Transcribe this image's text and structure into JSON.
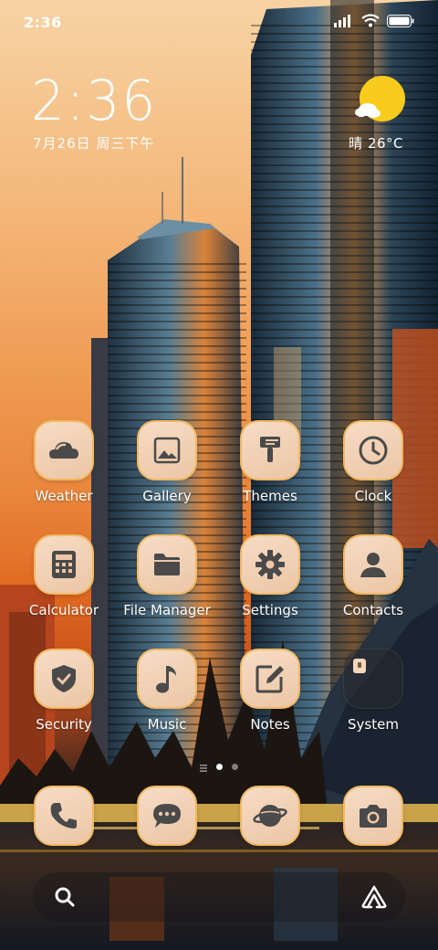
{
  "status_bar": {
    "time": "2:36"
  },
  "clock_widget": {
    "time": "2:36",
    "date": "7月26日 周三下午"
  },
  "weather_widget": {
    "condition": "晴",
    "temperature": "26°C"
  },
  "apps": [
    {
      "name": "Weather",
      "icon": "weather-icon"
    },
    {
      "name": "Gallery",
      "icon": "gallery-icon"
    },
    {
      "name": "Themes",
      "icon": "paintbrush-icon"
    },
    {
      "name": "Clock",
      "icon": "clock-icon"
    },
    {
      "name": "Calculator",
      "icon": "calculator-icon"
    },
    {
      "name": "File Manager",
      "icon": "folder-icon"
    },
    {
      "name": "Settings",
      "icon": "gear-icon"
    },
    {
      "name": "Contacts",
      "icon": "person-icon"
    },
    {
      "name": "Security",
      "icon": "shield-icon"
    },
    {
      "name": "Music",
      "icon": "music-note-icon"
    },
    {
      "name": "Notes",
      "icon": "notes-icon"
    },
    {
      "name": "System",
      "icon": "folder-icon"
    }
  ],
  "dock": [
    {
      "icon": "phone-icon"
    },
    {
      "icon": "message-icon"
    },
    {
      "icon": "browser-icon"
    },
    {
      "icon": "camera-icon"
    }
  ],
  "page_indicator": {
    "pages": 2,
    "current": 1
  },
  "colors": {
    "icon_bg": "#f3d6bc",
    "icon_border": "#f1b862",
    "glyph": "#4a4a4a",
    "sun": "#f7c820"
  }
}
